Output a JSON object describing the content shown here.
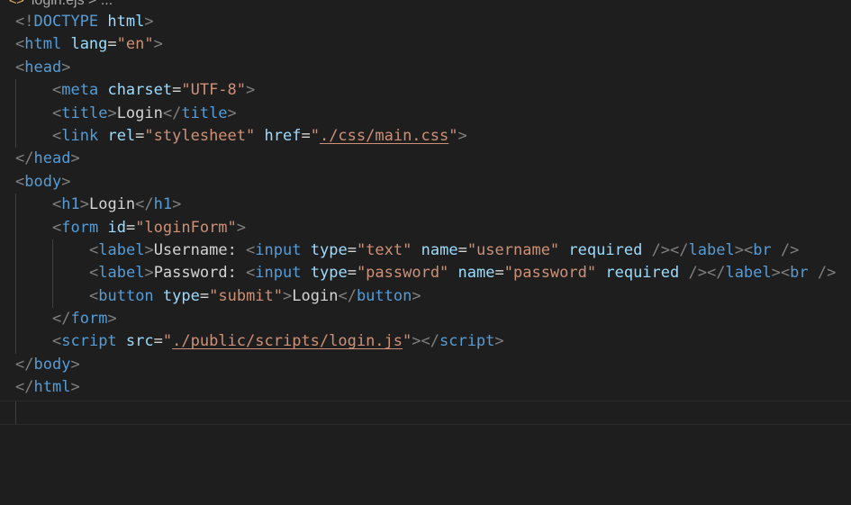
{
  "breadcrumb": {
    "file_icon": "<>",
    "file": "login.ejs",
    "sep": ">",
    "ellipsis": "..."
  },
  "code": {
    "doctype_open": "<!",
    "doctype_kw": "DOCTYPE",
    "doctype_html": "html",
    "html_tag": "html",
    "lang_attr": "lang",
    "lang_val": "\"en\"",
    "head_tag": "head",
    "meta_tag": "meta",
    "charset_attr": "charset",
    "charset_val": "\"UTF-8\"",
    "title_tag": "title",
    "title_text": "Login",
    "link_tag": "link",
    "rel_attr": "rel",
    "rel_val": "\"stylesheet\"",
    "href_attr": "href",
    "href_val": "./css/main.css",
    "body_tag": "body",
    "h1_tag": "h1",
    "h1_text": "Login",
    "form_tag": "form",
    "id_attr": "id",
    "id_val": "\"loginForm\"",
    "label_tag": "label",
    "username_text": "Username: ",
    "password_text": "Password: ",
    "input_tag": "input",
    "type_attr": "type",
    "type_text": "\"text\"",
    "type_password": "\"password\"",
    "name_attr": "name",
    "name_username": "\"username\"",
    "name_password": "\"password\"",
    "required_attr": "required",
    "br_tag": "br",
    "button_tag": "button",
    "type_submit": "\"submit\"",
    "button_text": "Login",
    "script_tag": "script",
    "src_attr": "src",
    "src_val": "./public/scripts/login.js"
  }
}
